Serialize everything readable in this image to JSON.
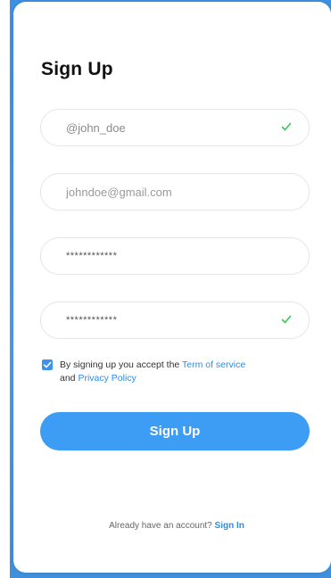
{
  "form": {
    "title": "Sign Up",
    "username": {
      "value": "@john_doe",
      "placeholder": "@john_doe"
    },
    "email": {
      "value": "",
      "placeholder": "johndoe@gmail.com"
    },
    "password": {
      "value": "************"
    },
    "confirm_password": {
      "value": "************"
    },
    "terms": {
      "text_before": "By signing up you accept the ",
      "terms_link": "Term of service",
      "text_and": "and ",
      "privacy_link": "Privacy Policy",
      "checked": true
    },
    "submit_label": "Sign Up"
  },
  "footer": {
    "prompt": "Already have an account? ",
    "signin_link": "Sign In"
  },
  "colors": {
    "primary": "#3d9cf4",
    "link": "#2f8be6",
    "check": "#3cc65a",
    "backdrop": "#4a9be8"
  },
  "icons": [
    "checkmark-icon",
    "checkbox-checked-icon"
  ]
}
